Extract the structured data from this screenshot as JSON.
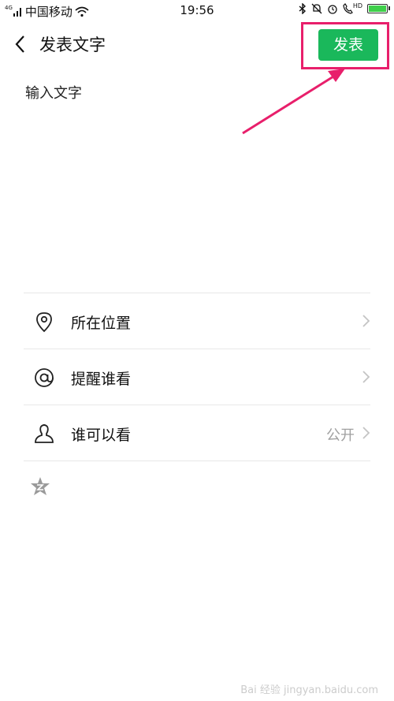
{
  "status": {
    "network_badge": "4G",
    "carrier": "中国移动",
    "time": "19:56",
    "hd_badge": "HD"
  },
  "nav": {
    "title": "发表文字",
    "publish_label": "发表"
  },
  "compose": {
    "placeholder": "输入文字"
  },
  "options": [
    {
      "label": "所在位置",
      "value": "",
      "icon": "location-pin-icon"
    },
    {
      "label": "提醒谁看",
      "value": "",
      "icon": "at-icon"
    },
    {
      "label": "谁可以看",
      "value": "公开",
      "icon": "person-icon"
    }
  ],
  "colors": {
    "accent_green": "#1ab85b",
    "highlight_pink": "#e81f6b"
  },
  "watermark": "Bai 经验  jingyan.baidu.com"
}
